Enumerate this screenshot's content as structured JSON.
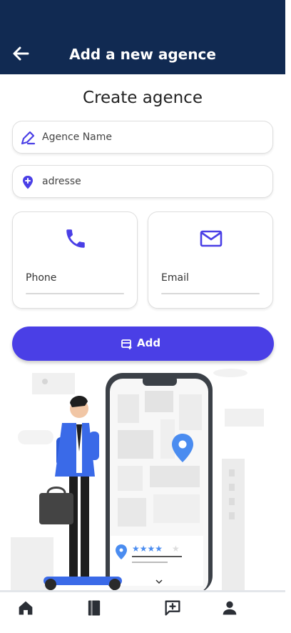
{
  "header": {
    "title": "Add a new agence",
    "back_icon": "arrow-left-icon"
  },
  "form": {
    "title": "Create agence",
    "agence_name_placeholder": "Agence Name",
    "adresse_placeholder": "adresse",
    "phone_label": "Phone",
    "email_label": "Email",
    "add_label": "Add"
  },
  "nav": {
    "items": [
      "home-icon",
      "book-icon",
      "add-comment-icon",
      "person-icon"
    ]
  },
  "colors": {
    "header_bg": "#112a52",
    "accent": "#4a3fe6",
    "map_pin": "#4a8cf0"
  }
}
